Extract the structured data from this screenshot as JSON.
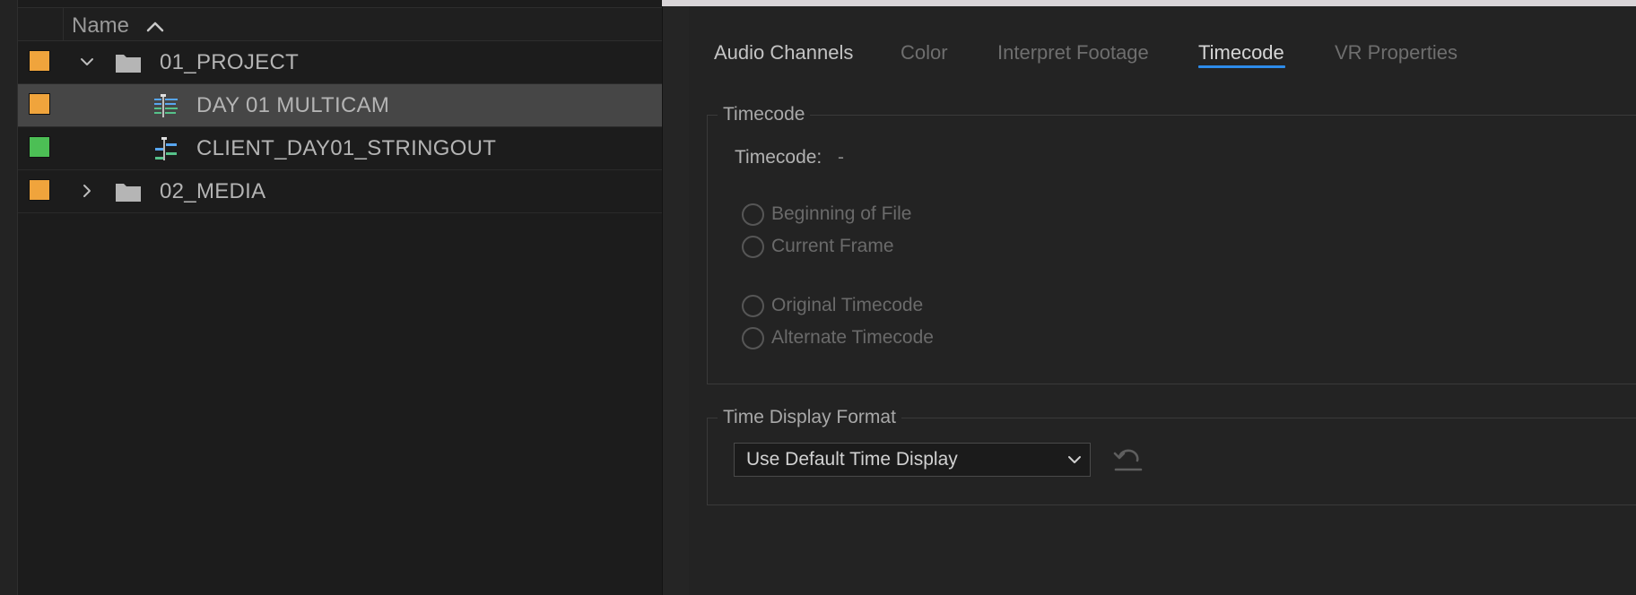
{
  "project_panel": {
    "column_header": {
      "name_label": "Name"
    },
    "rows": [
      {
        "label": "01_PROJECT",
        "color": "#f0a43c",
        "type": "folder",
        "expanded": true
      },
      {
        "label": "DAY 01 MULTICAM",
        "color": "#f0a43c",
        "type": "multicam-sequence",
        "selected": true
      },
      {
        "label": "CLIENT_DAY01_STRINGOUT",
        "color": "#4cbf55",
        "type": "sequence"
      },
      {
        "label": "02_MEDIA",
        "color": "#f0a43c",
        "type": "folder",
        "expanded": false
      }
    ]
  },
  "properties_panel": {
    "tabs": [
      {
        "label": "Audio Channels"
      },
      {
        "label": "Color"
      },
      {
        "label": "Interpret Footage"
      },
      {
        "label": "Timecode",
        "active": true
      },
      {
        "label": "VR Properties"
      }
    ],
    "timecode_group": {
      "title": "Timecode",
      "field_label": "Timecode:",
      "field_value": "-",
      "radios_start": [
        "Beginning of File",
        "Current Frame"
      ],
      "radios_source": [
        "Original Timecode",
        "Alternate Timecode"
      ]
    },
    "time_display_group": {
      "title": "Time Display Format",
      "selected_option": "Use Default Time Display"
    }
  },
  "colors": {
    "accent": "#2d8ceb",
    "label_orange": "#f0a43c",
    "label_green": "#4cbf55"
  }
}
